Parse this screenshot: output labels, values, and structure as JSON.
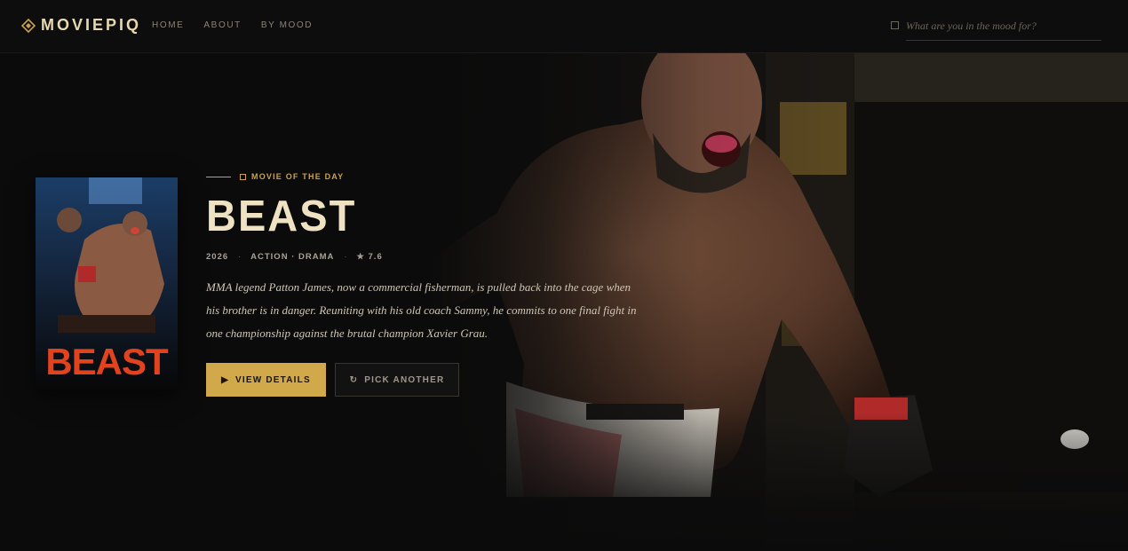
{
  "nav": {
    "brand": "MOVIEPIQ",
    "links": [
      "HOME",
      "ABOUT",
      "BY MOOD"
    ],
    "search_placeholder": "What are you in the mood for?"
  },
  "hero": {
    "eyebrow": "MOVIE OF THE DAY",
    "title": "BEAST",
    "year": "2026",
    "genres": "ACTION · DRAMA",
    "rating": "★ 7.6",
    "description": "MMA legend Patton James, now a commercial fisherman, is pulled back into the cage when his brother is in danger. Reuniting with his old coach Sammy, he commits to one final fight in one championship against the brutal champion Xavier Grau.",
    "poster_text": "BEAST",
    "buttons": {
      "primary_label": "VIEW DETAILS",
      "primary_icon": "play-icon",
      "secondary_label": "PICK ANOTHER",
      "secondary_icon": "refresh-icon"
    }
  },
  "colors": {
    "accent": "#d1a94a",
    "background": "#0b0b0b",
    "title": "#efe2c2",
    "poster_title": "#e2431f"
  }
}
